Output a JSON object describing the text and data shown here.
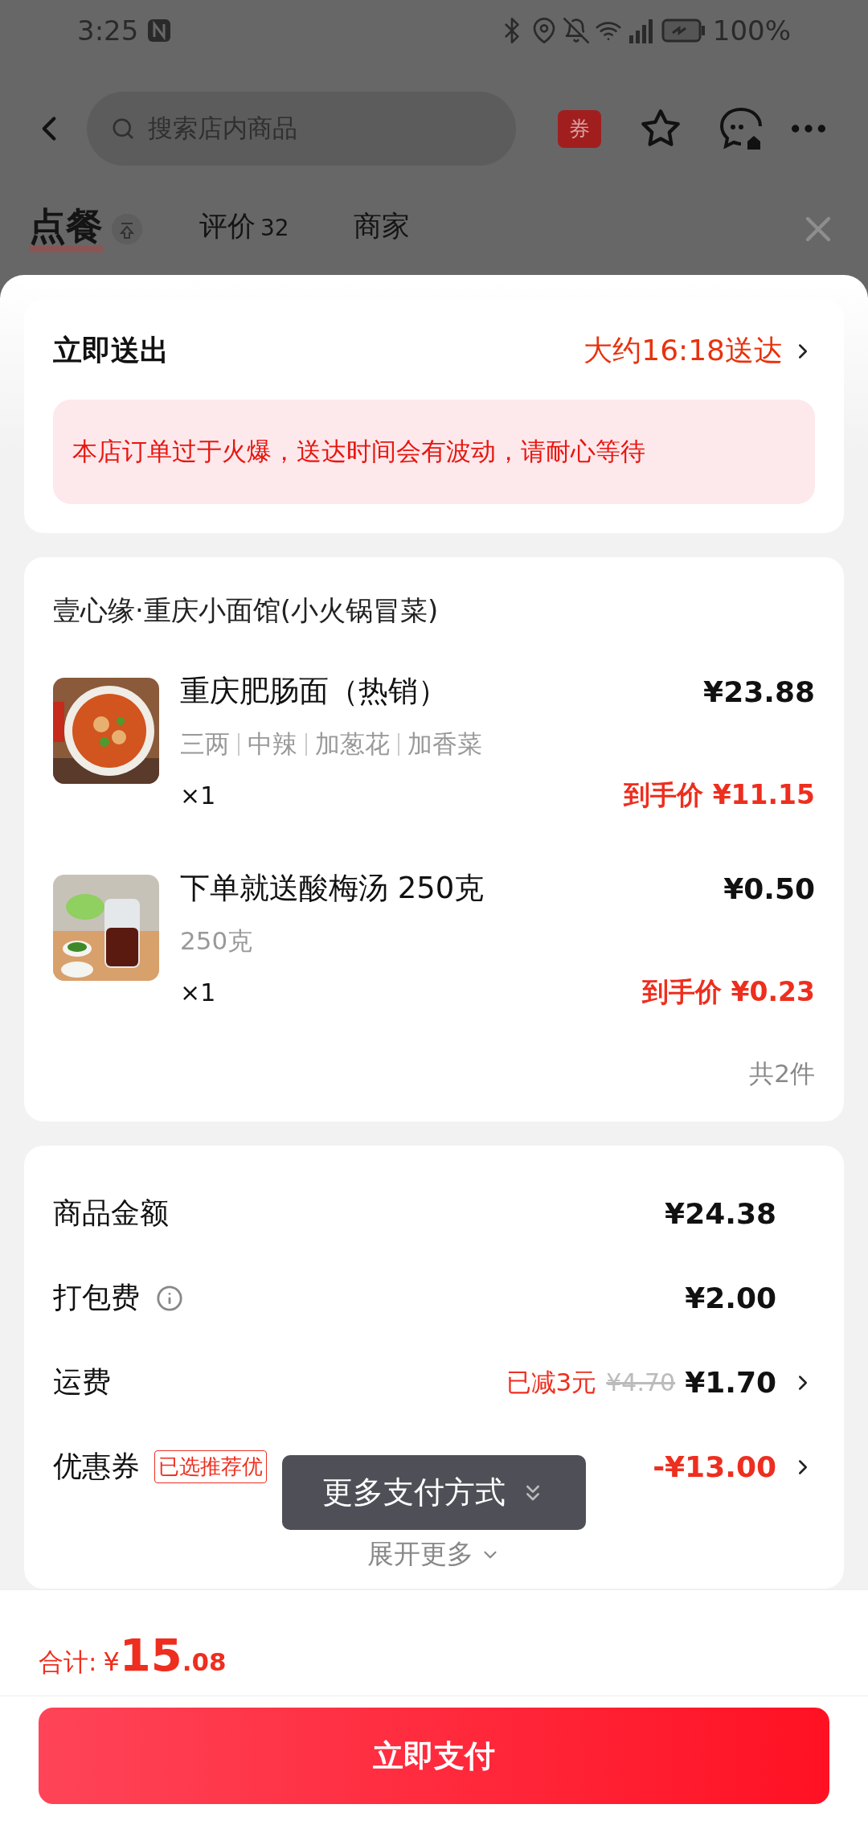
{
  "status_bar": {
    "time": "3:25",
    "battery": "100%"
  },
  "search": {
    "placeholder": "搜索店内商品"
  },
  "coupon_badge": "券",
  "tabs": [
    {
      "label": "点餐",
      "selected": true
    },
    {
      "label": "评价",
      "count": "32",
      "selected": false
    },
    {
      "label": "商家",
      "selected": false
    }
  ],
  "delivery": {
    "title": "立即送出",
    "eta": "大约16:18送达",
    "notice": "本店订单过于火爆，送达时间会有波动，请耐心等待"
  },
  "shop": {
    "name": "壹心缘·重庆小面馆(小火锅冒菜)",
    "items": [
      {
        "name": "重庆肥肠面（热销）",
        "specs": [
          "三两",
          "中辣",
          "加葱花",
          "加香菜"
        ],
        "qty": "×1",
        "price": "¥23.88",
        "final_label": "到手价",
        "final_price": "¥11.15",
        "image": {
          "kind": "picture"
        }
      },
      {
        "name": "下单就送酸梅汤 250克",
        "specs": [
          "250克"
        ],
        "qty": "×1",
        "price": "¥0.50",
        "final_label": "到手价",
        "final_price": "¥0.23",
        "image": {
          "kind": "picture"
        }
      }
    ],
    "count": "共2件"
  },
  "fees": [
    {
      "label": "商品金额",
      "kind": "amount",
      "value": "¥24.38",
      "info": false,
      "arrow": false
    },
    {
      "label": "打包费",
      "kind": "amount",
      "value": "¥2.00",
      "info": true,
      "arrow": false
    },
    {
      "label": "运费",
      "kind": "amount",
      "value": "¥1.70",
      "note": "已减3元",
      "original": "¥4.70",
      "info": false,
      "arrow": true
    },
    {
      "label": "优惠券",
      "kind": "discount",
      "value": "-¥13.00",
      "tag": "已选推荐优",
      "info": false,
      "arrow": true
    }
  ],
  "expand": "展开更多",
  "toast": "更多支付方式",
  "total": {
    "label": "合计:",
    "currency": "¥",
    "integer": "15",
    "decimal": ".08"
  },
  "pay_button": "立即支付"
}
